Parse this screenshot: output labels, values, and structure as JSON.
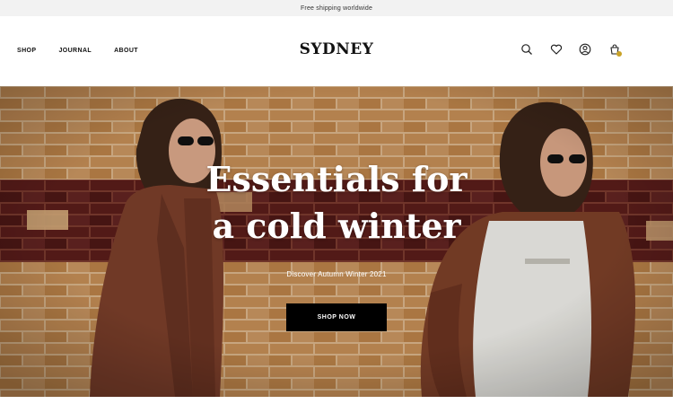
{
  "announcement": {
    "text": "Free shipping worldwide"
  },
  "nav": {
    "items": [
      "SHOP",
      "JOURNAL",
      "ABOUT"
    ]
  },
  "brand": {
    "logo": "SYDNEY"
  },
  "header_icons": [
    "search-icon",
    "heart-icon",
    "account-icon",
    "cart-icon"
  ],
  "cart": {
    "badge_color": "#c9a227"
  },
  "hero": {
    "title_line1": "Essentials for",
    "title_line2": "a cold winter",
    "subtitle": "Discover Autumn Winter 2021",
    "cta_label": "SHOP NOW"
  },
  "colors": {
    "brick": "#c08a52",
    "brick_dark": "#5a1d1a",
    "mortar": "#d8b48a",
    "button": "#000000"
  }
}
